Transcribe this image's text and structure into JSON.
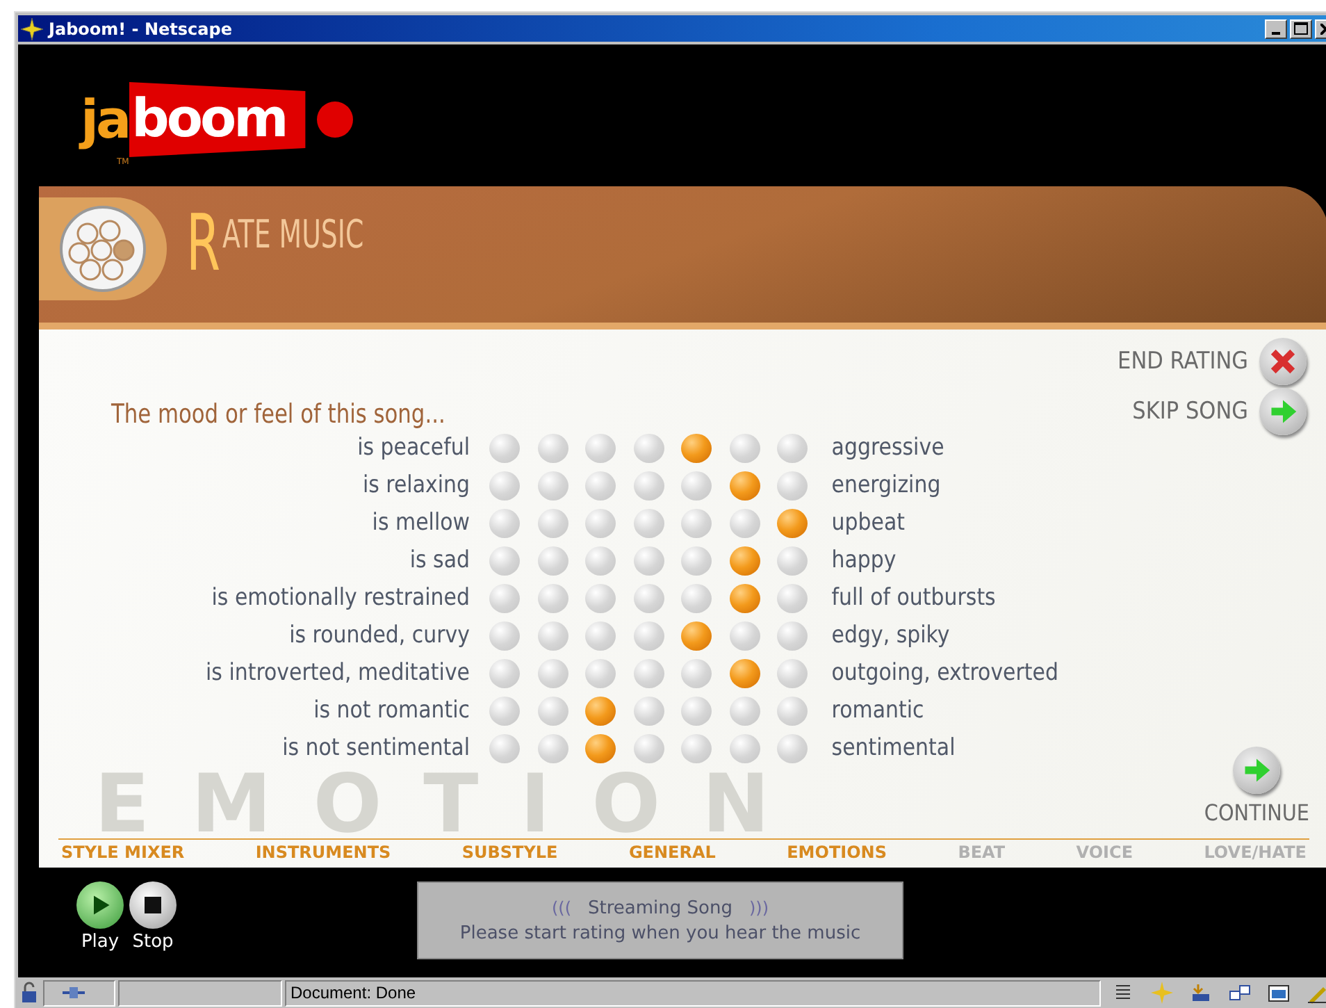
{
  "window": {
    "title": "Jaboom! - Netscape"
  },
  "logo": {
    "part_1": "ja",
    "part_2": "boom",
    "trademark": "TM"
  },
  "header": {
    "initial": "R",
    "title": "ATE MUSIC"
  },
  "actions": [
    {
      "label": "END RATING",
      "kind": "close"
    },
    {
      "label": "SKIP SONG",
      "kind": "next"
    }
  ],
  "prompt": "The mood or feel of this song...",
  "background_word": "EMOTION",
  "scales": [
    {
      "left": "is peaceful",
      "right": "aggressive",
      "dots": [
        {
          "selected": false
        },
        {
          "selected": false
        },
        {
          "selected": false
        },
        {
          "selected": false
        },
        {
          "selected": true
        },
        {
          "selected": false
        },
        {
          "selected": false
        }
      ]
    },
    {
      "left": "is relaxing",
      "right": "energizing",
      "dots": [
        {
          "selected": false
        },
        {
          "selected": false
        },
        {
          "selected": false
        },
        {
          "selected": false
        },
        {
          "selected": false
        },
        {
          "selected": true
        },
        {
          "selected": false
        }
      ]
    },
    {
      "left": "is mellow",
      "right": "upbeat",
      "dots": [
        {
          "selected": false
        },
        {
          "selected": false
        },
        {
          "selected": false
        },
        {
          "selected": false
        },
        {
          "selected": false
        },
        {
          "selected": false
        },
        {
          "selected": true
        }
      ]
    },
    {
      "left": "is sad",
      "right": "happy",
      "dots": [
        {
          "selected": false
        },
        {
          "selected": false
        },
        {
          "selected": false
        },
        {
          "selected": false
        },
        {
          "selected": false
        },
        {
          "selected": true
        },
        {
          "selected": false
        }
      ]
    },
    {
      "left": "is emotionally restrained",
      "right": "full of outbursts",
      "dots": [
        {
          "selected": false
        },
        {
          "selected": false
        },
        {
          "selected": false
        },
        {
          "selected": false
        },
        {
          "selected": false
        },
        {
          "selected": true
        },
        {
          "selected": false
        }
      ]
    },
    {
      "left": "is rounded, curvy",
      "right": "edgy, spiky",
      "dots": [
        {
          "selected": false
        },
        {
          "selected": false
        },
        {
          "selected": false
        },
        {
          "selected": false
        },
        {
          "selected": true
        },
        {
          "selected": false
        },
        {
          "selected": false
        }
      ]
    },
    {
      "left": "is introverted, meditative",
      "right": "outgoing, extroverted",
      "dots": [
        {
          "selected": false
        },
        {
          "selected": false
        },
        {
          "selected": false
        },
        {
          "selected": false
        },
        {
          "selected": false
        },
        {
          "selected": true
        },
        {
          "selected": false
        }
      ]
    },
    {
      "left": "is not romantic",
      "right": "romantic",
      "dots": [
        {
          "selected": false
        },
        {
          "selected": false
        },
        {
          "selected": true
        },
        {
          "selected": false
        },
        {
          "selected": false
        },
        {
          "selected": false
        },
        {
          "selected": false
        }
      ]
    },
    {
      "left": "is not sentimental",
      "right": "sentimental",
      "dots": [
        {
          "selected": false
        },
        {
          "selected": false
        },
        {
          "selected": true
        },
        {
          "selected": false
        },
        {
          "selected": false
        },
        {
          "selected": false
        },
        {
          "selected": false
        }
      ]
    }
  ],
  "continue": "CONTINUE",
  "sections": [
    {
      "label": "STYLE MIXER",
      "disabled": false
    },
    {
      "label": "INSTRUMENTS",
      "disabled": false
    },
    {
      "label": "SUBSTYLE",
      "disabled": false
    },
    {
      "label": "GENERAL",
      "disabled": false
    },
    {
      "label": "EMOTIONS",
      "disabled": false
    },
    {
      "label": "BEAT",
      "disabled": true
    },
    {
      "label": "VOICE",
      "disabled": true
    },
    {
      "label": "LOVE/HATE",
      "disabled": true
    }
  ],
  "player": [
    {
      "label": "Play",
      "kind": "play"
    },
    {
      "label": "Stop",
      "kind": "stop"
    }
  ],
  "stream": {
    "open": "(((",
    "title": "Streaming Song",
    "close": ")))",
    "message": "Please start rating when you hear the music"
  },
  "status_bar": {
    "text": "Document: Done"
  }
}
